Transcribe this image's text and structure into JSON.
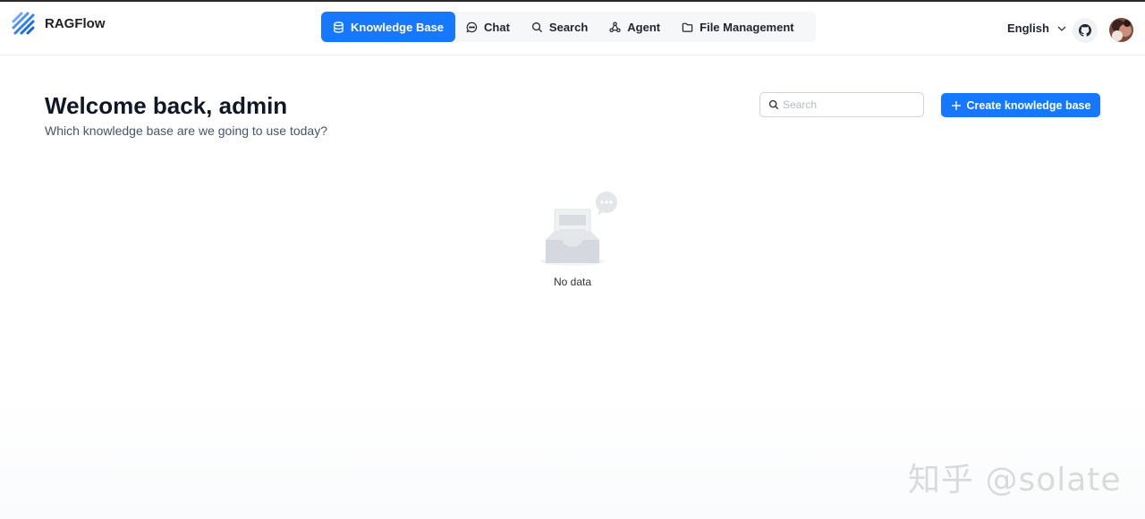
{
  "app": {
    "name": "RAGFlow"
  },
  "nav": {
    "items": [
      {
        "label": "Knowledge Base",
        "icon": "database-icon",
        "active": true
      },
      {
        "label": "Chat",
        "icon": "chat-icon",
        "active": false
      },
      {
        "label": "Search",
        "icon": "search-icon",
        "active": false
      },
      {
        "label": "Agent",
        "icon": "agent-icon",
        "active": false
      },
      {
        "label": "File Management",
        "icon": "folder-icon",
        "active": false
      }
    ]
  },
  "header": {
    "language": "English"
  },
  "main": {
    "welcome": "Welcome back, admin",
    "subtitle": "Which knowledge base are we going to use today?",
    "search": {
      "placeholder": "Search",
      "value": ""
    },
    "create_button": "Create knowledge base",
    "empty_text": "No data"
  },
  "watermark": "知乎 @solate",
  "colors": {
    "accent": "#1677ff",
    "heading": "#101828",
    "muted": "#475467"
  }
}
